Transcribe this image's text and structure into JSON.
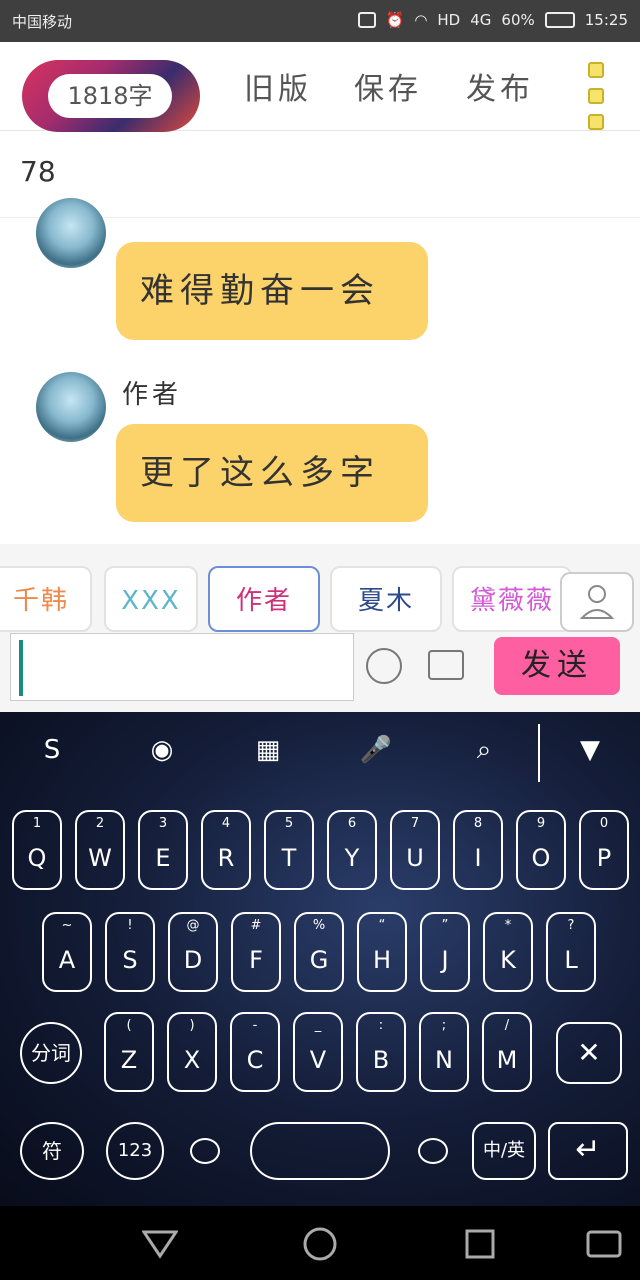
{
  "status_bar": {
    "carrier": "中国移动",
    "battery": "60%",
    "time": "15:25",
    "network": "4G",
    "hd": "HD"
  },
  "topbar": {
    "word_count": "1818字",
    "old_version": "旧版",
    "save": "保存",
    "publish": "发布"
  },
  "chapter": {
    "value": "78"
  },
  "messages": [
    {
      "author": "",
      "text": "难得勤奋一会"
    },
    {
      "author": "作者",
      "text": "更了这么多字"
    }
  ],
  "roles": [
    {
      "label": "千韩",
      "color": "#f08a4b"
    },
    {
      "label": "XXX",
      "color": "#5bb6c9"
    },
    {
      "label": "作者",
      "color": "#d0307a"
    },
    {
      "label": "夏木",
      "color": "#2c4a8c"
    },
    {
      "label": "黛薇薇",
      "color": "#d35ad6"
    }
  ],
  "composer": {
    "send": "发送"
  },
  "keyboard": {
    "row1": [
      [
        "1",
        "Q"
      ],
      [
        "2",
        "W"
      ],
      [
        "3",
        "E"
      ],
      [
        "4",
        "R"
      ],
      [
        "5",
        "T"
      ],
      [
        "6",
        "Y"
      ],
      [
        "7",
        "U"
      ],
      [
        "8",
        "I"
      ],
      [
        "9",
        "O"
      ],
      [
        "0",
        "P"
      ]
    ],
    "row2": [
      [
        "~",
        "A"
      ],
      [
        "!",
        "S"
      ],
      [
        "@",
        "D"
      ],
      [
        "#",
        "F"
      ],
      [
        "%",
        "G"
      ],
      [
        "“",
        "H"
      ],
      [
        "”",
        "J"
      ],
      [
        "*",
        "K"
      ],
      [
        "?",
        "L"
      ]
    ],
    "row3": [
      [
        "(",
        "Z"
      ],
      [
        ")",
        "X"
      ],
      [
        "-",
        "C"
      ],
      [
        "_",
        "V"
      ],
      [
        ":",
        "B"
      ],
      [
        ";",
        "N"
      ],
      [
        "/",
        "M"
      ]
    ],
    "fenci": "分词",
    "fu": "符",
    "num": "123",
    "lang": "中/英"
  }
}
